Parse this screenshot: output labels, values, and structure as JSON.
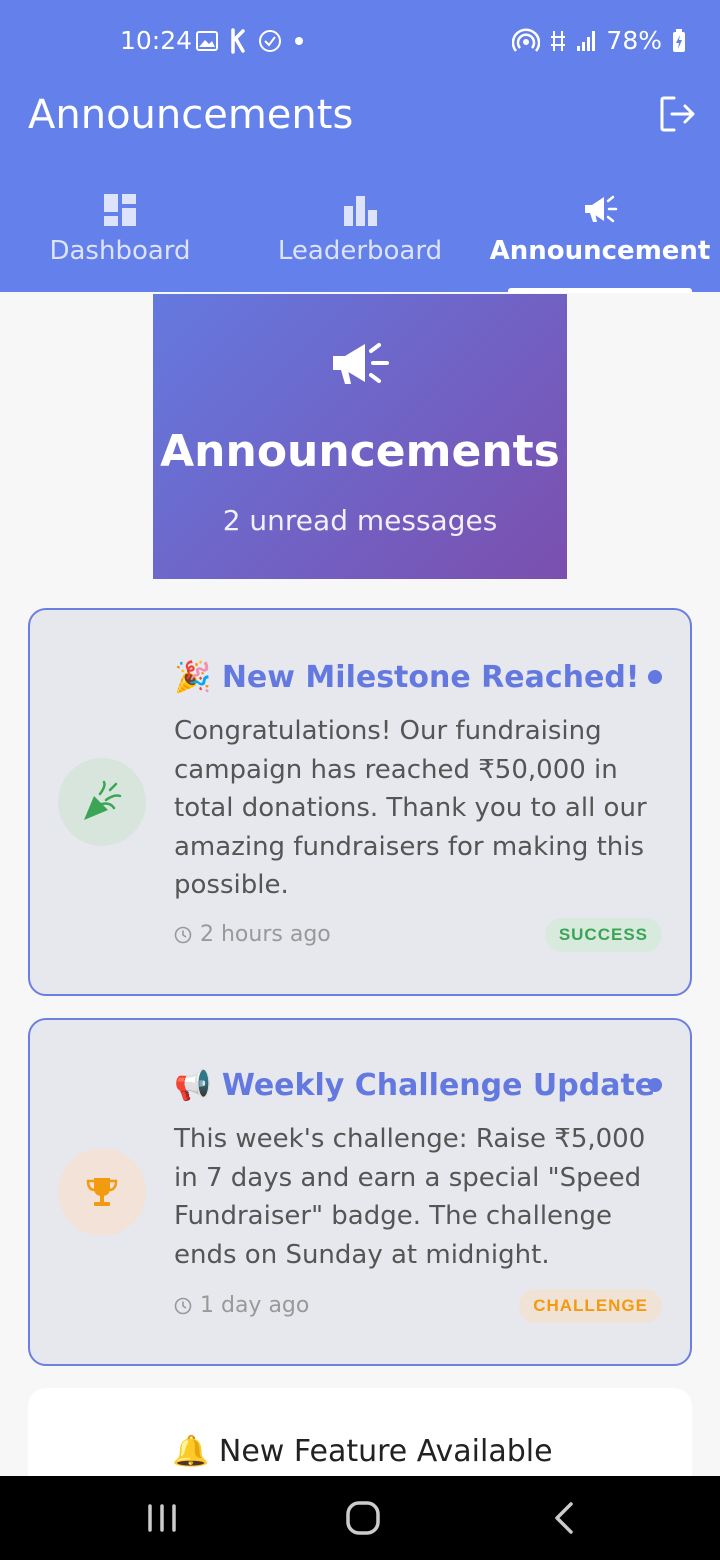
{
  "status_bar": {
    "time": "10:24",
    "battery": "78%",
    "left_icons": [
      "image-icon",
      "k-app-icon",
      "check-circle-icon",
      "dot-icon"
    ],
    "right_icons": [
      "hotspot-icon",
      "data-icon",
      "signal-icon",
      "battery-icon"
    ]
  },
  "header": {
    "title": "Announcements",
    "bg_color": "#6480ea"
  },
  "tabs": [
    {
      "label": "Dashboard",
      "icon": "dashboard-icon",
      "active": false
    },
    {
      "label": "Leaderboard",
      "icon": "leaderboard-icon",
      "active": false
    },
    {
      "label": "Announcement",
      "icon": "megaphone-icon",
      "active": true
    }
  ],
  "hero": {
    "title": "Announcements",
    "subtitle": "2 unread messages"
  },
  "announcements": [
    {
      "emoji": "🎉",
      "title": "New Milestone Reached!",
      "body": "Congratulations! Our fundraising campaign has reached ₹50,000 in total donations. Thank you to all our amazing fundraisers for making this possible.",
      "time": "2 hours ago",
      "badge": "SUCCESS",
      "badge_color": "#3aa655",
      "icon": "party-popper-icon",
      "unread": true
    },
    {
      "emoji": "📢",
      "title": "Weekly Challenge Update",
      "body": "This week's challenge: Raise ₹5,000 in 7 days and earn a special \"Speed Fundraiser\" badge. The challenge ends on Sunday at midnight.",
      "time": "1 day ago",
      "badge": "CHALLENGE",
      "badge_color": "#f29a10",
      "icon": "trophy-icon",
      "unread": true
    },
    {
      "emoji": "🔔",
      "title": "New Feature Available"
    }
  ]
}
